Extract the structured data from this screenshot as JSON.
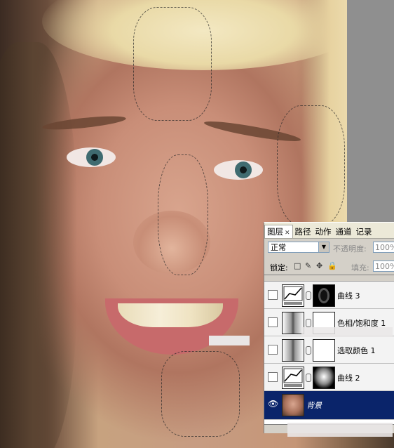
{
  "panel": {
    "tabs": [
      {
        "label": "图层",
        "active": true
      },
      {
        "label": "路径",
        "active": false
      },
      {
        "label": "动作",
        "active": false
      },
      {
        "label": "通道",
        "active": false
      },
      {
        "label": "记录",
        "active": false
      }
    ],
    "blend_mode": "正常",
    "opacity_label": "不透明度:",
    "opacity_value": "100%",
    "lock_label": "锁定:",
    "fill_label": "填充:",
    "fill_value": "100%",
    "layers": [
      {
        "name": "曲线 3",
        "visible": false,
        "thumb": "curves-icon",
        "mask": "face-mask",
        "selected": false
      },
      {
        "name": "色相/饱和度 1",
        "visible": false,
        "thumb": "gradient",
        "mask": "white-mask",
        "selected": false
      },
      {
        "name": "选取颜色 1",
        "visible": false,
        "thumb": "gradient",
        "mask": "white-mask",
        "selected": false
      },
      {
        "name": "曲线 2",
        "visible": false,
        "thumb": "curves-icon",
        "mask": "face-mask",
        "selected": false
      },
      {
        "name": "背景",
        "visible": true,
        "thumb": "photo",
        "mask": null,
        "selected": true
      }
    ]
  }
}
